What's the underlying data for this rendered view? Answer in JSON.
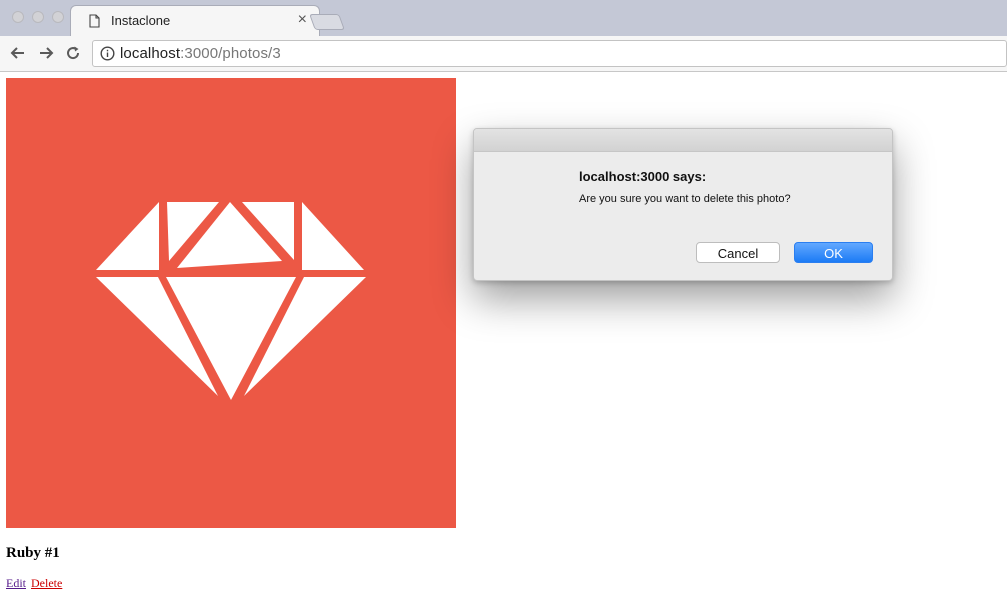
{
  "browser": {
    "tab_title": "Instaclone",
    "url_host": "localhost",
    "url_path": ":3000/photos/3",
    "icons": [
      "back-arrow-icon",
      "forward-arrow-icon",
      "reload-icon",
      "info-icon",
      "document-icon",
      "close-icon"
    ]
  },
  "page": {
    "photo_bg_color": "#ec5845",
    "photo_icon": "ruby-gem-icon",
    "caption": "Ruby #1",
    "edit_link": "Edit",
    "delete_link": "Delete"
  },
  "dialog": {
    "title": "localhost:3000 says:",
    "message": "Are you sure you want to delete this photo?",
    "cancel_label": "Cancel",
    "ok_label": "OK",
    "ok_color": "#1c7bf5"
  }
}
